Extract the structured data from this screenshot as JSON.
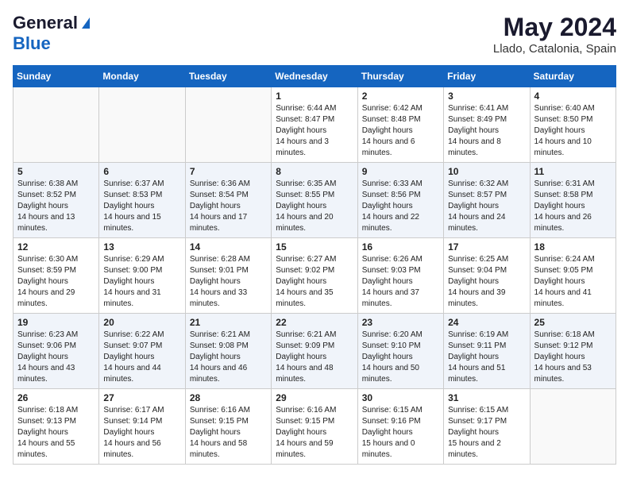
{
  "header": {
    "logo_general": "General",
    "logo_blue": "Blue",
    "month": "May 2024",
    "location": "Llado, Catalonia, Spain"
  },
  "days_of_week": [
    "Sunday",
    "Monday",
    "Tuesday",
    "Wednesday",
    "Thursday",
    "Friday",
    "Saturday"
  ],
  "weeks": [
    [
      {
        "day": "",
        "empty": true
      },
      {
        "day": "",
        "empty": true
      },
      {
        "day": "",
        "empty": true
      },
      {
        "day": "1",
        "sunrise": "6:44 AM",
        "sunset": "8:47 PM",
        "daylight": "14 hours and 3 minutes."
      },
      {
        "day": "2",
        "sunrise": "6:42 AM",
        "sunset": "8:48 PM",
        "daylight": "14 hours and 6 minutes."
      },
      {
        "day": "3",
        "sunrise": "6:41 AM",
        "sunset": "8:49 PM",
        "daylight": "14 hours and 8 minutes."
      },
      {
        "day": "4",
        "sunrise": "6:40 AM",
        "sunset": "8:50 PM",
        "daylight": "14 hours and 10 minutes."
      }
    ],
    [
      {
        "day": "5",
        "sunrise": "6:38 AM",
        "sunset": "8:52 PM",
        "daylight": "14 hours and 13 minutes."
      },
      {
        "day": "6",
        "sunrise": "6:37 AM",
        "sunset": "8:53 PM",
        "daylight": "14 hours and 15 minutes."
      },
      {
        "day": "7",
        "sunrise": "6:36 AM",
        "sunset": "8:54 PM",
        "daylight": "14 hours and 17 minutes."
      },
      {
        "day": "8",
        "sunrise": "6:35 AM",
        "sunset": "8:55 PM",
        "daylight": "14 hours and 20 minutes."
      },
      {
        "day": "9",
        "sunrise": "6:33 AM",
        "sunset": "8:56 PM",
        "daylight": "14 hours and 22 minutes."
      },
      {
        "day": "10",
        "sunrise": "6:32 AM",
        "sunset": "8:57 PM",
        "daylight": "14 hours and 24 minutes."
      },
      {
        "day": "11",
        "sunrise": "6:31 AM",
        "sunset": "8:58 PM",
        "daylight": "14 hours and 26 minutes."
      }
    ],
    [
      {
        "day": "12",
        "sunrise": "6:30 AM",
        "sunset": "8:59 PM",
        "daylight": "14 hours and 29 minutes."
      },
      {
        "day": "13",
        "sunrise": "6:29 AM",
        "sunset": "9:00 PM",
        "daylight": "14 hours and 31 minutes."
      },
      {
        "day": "14",
        "sunrise": "6:28 AM",
        "sunset": "9:01 PM",
        "daylight": "14 hours and 33 minutes."
      },
      {
        "day": "15",
        "sunrise": "6:27 AM",
        "sunset": "9:02 PM",
        "daylight": "14 hours and 35 minutes."
      },
      {
        "day": "16",
        "sunrise": "6:26 AM",
        "sunset": "9:03 PM",
        "daylight": "14 hours and 37 minutes."
      },
      {
        "day": "17",
        "sunrise": "6:25 AM",
        "sunset": "9:04 PM",
        "daylight": "14 hours and 39 minutes."
      },
      {
        "day": "18",
        "sunrise": "6:24 AM",
        "sunset": "9:05 PM",
        "daylight": "14 hours and 41 minutes."
      }
    ],
    [
      {
        "day": "19",
        "sunrise": "6:23 AM",
        "sunset": "9:06 PM",
        "daylight": "14 hours and 43 minutes."
      },
      {
        "day": "20",
        "sunrise": "6:22 AM",
        "sunset": "9:07 PM",
        "daylight": "14 hours and 44 minutes."
      },
      {
        "day": "21",
        "sunrise": "6:21 AM",
        "sunset": "9:08 PM",
        "daylight": "14 hours and 46 minutes."
      },
      {
        "day": "22",
        "sunrise": "6:21 AM",
        "sunset": "9:09 PM",
        "daylight": "14 hours and 48 minutes."
      },
      {
        "day": "23",
        "sunrise": "6:20 AM",
        "sunset": "9:10 PM",
        "daylight": "14 hours and 50 minutes."
      },
      {
        "day": "24",
        "sunrise": "6:19 AM",
        "sunset": "9:11 PM",
        "daylight": "14 hours and 51 minutes."
      },
      {
        "day": "25",
        "sunrise": "6:18 AM",
        "sunset": "9:12 PM",
        "daylight": "14 hours and 53 minutes."
      }
    ],
    [
      {
        "day": "26",
        "sunrise": "6:18 AM",
        "sunset": "9:13 PM",
        "daylight": "14 hours and 55 minutes."
      },
      {
        "day": "27",
        "sunrise": "6:17 AM",
        "sunset": "9:14 PM",
        "daylight": "14 hours and 56 minutes."
      },
      {
        "day": "28",
        "sunrise": "6:16 AM",
        "sunset": "9:15 PM",
        "daylight": "14 hours and 58 minutes."
      },
      {
        "day": "29",
        "sunrise": "6:16 AM",
        "sunset": "9:15 PM",
        "daylight": "14 hours and 59 minutes."
      },
      {
        "day": "30",
        "sunrise": "6:15 AM",
        "sunset": "9:16 PM",
        "daylight": "15 hours and 0 minutes."
      },
      {
        "day": "31",
        "sunrise": "6:15 AM",
        "sunset": "9:17 PM",
        "daylight": "15 hours and 2 minutes."
      },
      {
        "day": "",
        "empty": true
      }
    ]
  ],
  "labels": {
    "sunrise": "Sunrise:",
    "sunset": "Sunset:",
    "daylight": "Daylight hours"
  }
}
